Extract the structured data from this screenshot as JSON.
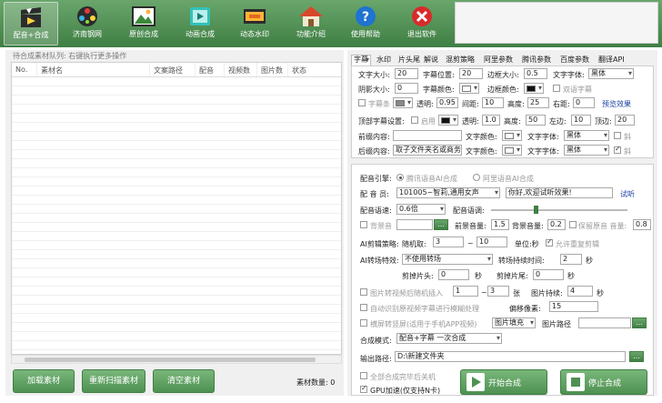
{
  "toolbar": {
    "buttons": [
      {
        "label": "配音+合成",
        "icon": "clapperboard-icon",
        "active": true
      },
      {
        "label": "济南钢网",
        "icon": "film-reel-icon",
        "active": false
      },
      {
        "label": "原创合成",
        "icon": "picture-icon",
        "active": false
      },
      {
        "label": "动画合成",
        "icon": "film-icon",
        "active": false
      },
      {
        "label": "动态水印",
        "icon": "watermark-icon",
        "active": false
      },
      {
        "label": "功能介绍",
        "icon": "house-icon",
        "active": false
      },
      {
        "label": "使用帮助",
        "icon": "help-icon",
        "active": false
      },
      {
        "label": "退出软件",
        "icon": "exit-icon",
        "active": false
      }
    ]
  },
  "queue": {
    "title": "待合成素材队列: 右键执行更多操作",
    "columns": [
      "No.",
      "素材名",
      "文案路径",
      "配音",
      "视频数",
      "图片数",
      "状态"
    ]
  },
  "left_buttons": {
    "load": "加载素材",
    "rescan": "重新扫描素材",
    "clear": "清空素材",
    "count_label": "素材数量: 0"
  },
  "tabs": [
    "字幕",
    "水印",
    "片头尾",
    "解说",
    "混剪策略",
    "阿里参数",
    "腾讯参数",
    "百度参数",
    "翻译API"
  ],
  "subtitle": {
    "font_size_label": "文字大小:",
    "font_size": "20",
    "position_label": "字幕位置:",
    "position": "20",
    "border_size_label": "边框大小:",
    "border_size": "0.5",
    "font_label": "文字字体:",
    "font": "黑体",
    "shadow_label": "阴影大小:",
    "shadow": "0",
    "text_color_label": "字幕颜色:",
    "border_color_label": "边框颜色:",
    "bilingual_label": "双语字幕",
    "subtitle_bar_label": "字幕条",
    "opacity_label": "透明:",
    "opacity": "0.95",
    "spacing_label": "间距:",
    "spacing": "10",
    "height_label": "高度:",
    "height": "25",
    "right_margin_label": "右距:",
    "right_margin": "0",
    "preview_label": "预览效果",
    "top_setting_label": "顶部字幕设置:",
    "enable_label": "启用",
    "top_opacity_label": "透明:",
    "top_opacity": "1.0",
    "top_height_label": "高度:",
    "top_height": "50",
    "left_margin_label": "左边:",
    "left_margin": "10",
    "top_margin_label": "顶边:",
    "top_margin": "20",
    "prefix_label": "前缀内容:",
    "prefix": "",
    "prefix_color_label": "文字颜色:",
    "prefix_font_label": "文字字体:",
    "prefix_font": "黑体",
    "prefix_italic": "斜",
    "suffix_label": "后缀内容:",
    "suffix": "取子文件夹名或商务",
    "suffix_color_label": "文字颜色:",
    "suffix_font_label": "文字字体:",
    "suffix_font": "黑体",
    "suffix_italic": "斜"
  },
  "dubbing": {
    "engine_label": "配音引擎:",
    "engine_tencent": "腾讯语音AI合成",
    "engine_ali": "阿里语音AI合成",
    "voice_label": "配 音 员:",
    "voice": "101005~智莉,通用女声",
    "test_text": "你好,欢迎试听效果!",
    "listen": "试听",
    "speed_label": "配音语速:",
    "speed": "0.6倍",
    "pitch_label": "配音语调:",
    "bgm_label": "背景音",
    "pre_volume_label": "前景音量:",
    "pre_volume": "1.5",
    "bg_volume_label": "背景音量:",
    "bg_volume": "0.2",
    "keep_original_label": "保留原音 音量:",
    "keep_original": "0.8",
    "ai_strategy_label": "AI剪辑策略:",
    "random_label": "随机取:",
    "random_from": "3",
    "dash": "~",
    "random_to": "10",
    "unit_label": "单位:秒",
    "allow_repeat": "允许重复剪辑",
    "transition_label": "AI转场特效:",
    "transition": "不使用转场",
    "transition_time_label": "转场持续时间:",
    "transition_time": "2",
    "sec": "秒",
    "cut_head_label": "剪掉片头:",
    "cut_head": "0",
    "cut_tail_label": "剪掉片尾:",
    "cut_tail": "0",
    "img_insert_label": "图片转视频后随机插入",
    "img_from": "1",
    "img_to": "3",
    "zhang": "张",
    "img_duration_label": "图片持续:",
    "img_duration": "4",
    "auto_blur_label": "自动识别原视频字幕进行模糊处理",
    "offset_label": "偏移像素:",
    "offset": "15",
    "landscape_label": "横屏转竖屏(适用于手机APP视频)",
    "fill_mode": "图片填充",
    "img_path_label": "图片路径",
    "compose_mode_label": "合成模式:",
    "compose_mode": "配音+字幕 一次合成",
    "output_label": "输出路径:",
    "output": "D:\\新建文件夹",
    "shutdown_label": "全部合成完毕后关机",
    "gpu_label": "GPU加速(仅支持N卡)",
    "start_button": "开始合成",
    "stop_button": "停止合成"
  }
}
